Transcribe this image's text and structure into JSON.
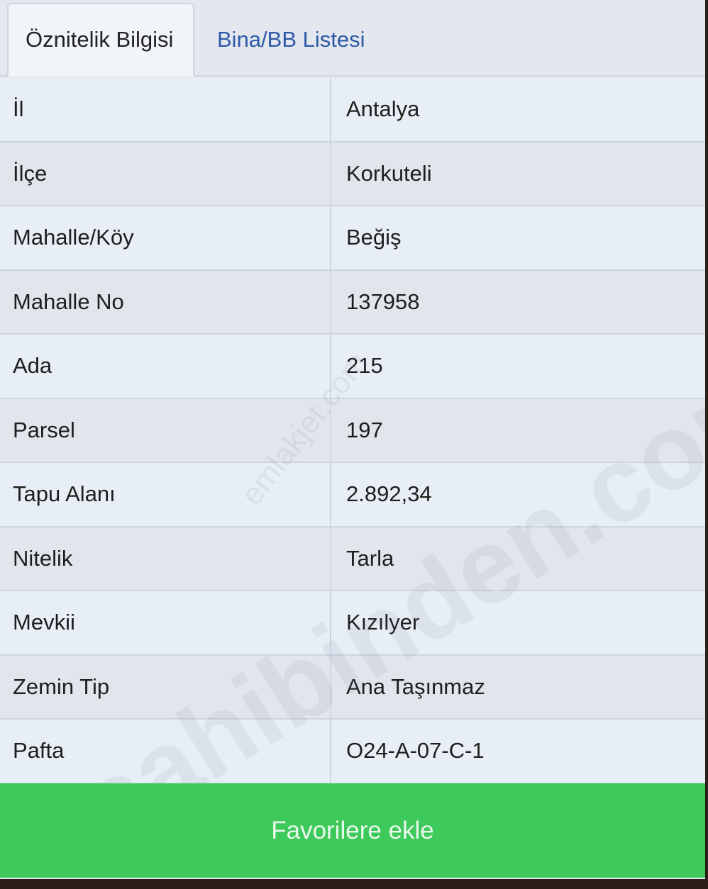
{
  "tabs": [
    {
      "label": "Öznitelik Bilgisi",
      "active": true
    },
    {
      "label": "Bina/BB Listesi",
      "active": false
    }
  ],
  "rows": [
    {
      "label": "İl",
      "value": "Antalya"
    },
    {
      "label": "İlçe",
      "value": "Korkuteli"
    },
    {
      "label": "Mahalle/Köy",
      "value": "Beğiş"
    },
    {
      "label": "Mahalle No",
      "value": "137958"
    },
    {
      "label": "Ada",
      "value": "215"
    },
    {
      "label": "Parsel",
      "value": "197"
    },
    {
      "label": "Tapu Alanı",
      "value": "2.892,34"
    },
    {
      "label": "Nitelik",
      "value": "Tarla"
    },
    {
      "label": "Mevkii",
      "value": "Kızılyer"
    },
    {
      "label": "Zemin Tip",
      "value": "Ana Taşınmaz"
    },
    {
      "label": "Pafta",
      "value": "O24-A-07-C-1"
    }
  ],
  "favorite_button": {
    "label": "Favorilere ekle"
  },
  "watermarks": {
    "small": "emlakjet.com",
    "large": "sahibinden.com"
  },
  "colors": {
    "button_green": "#3dca5a",
    "tab_link_blue": "#2e5aa8"
  }
}
